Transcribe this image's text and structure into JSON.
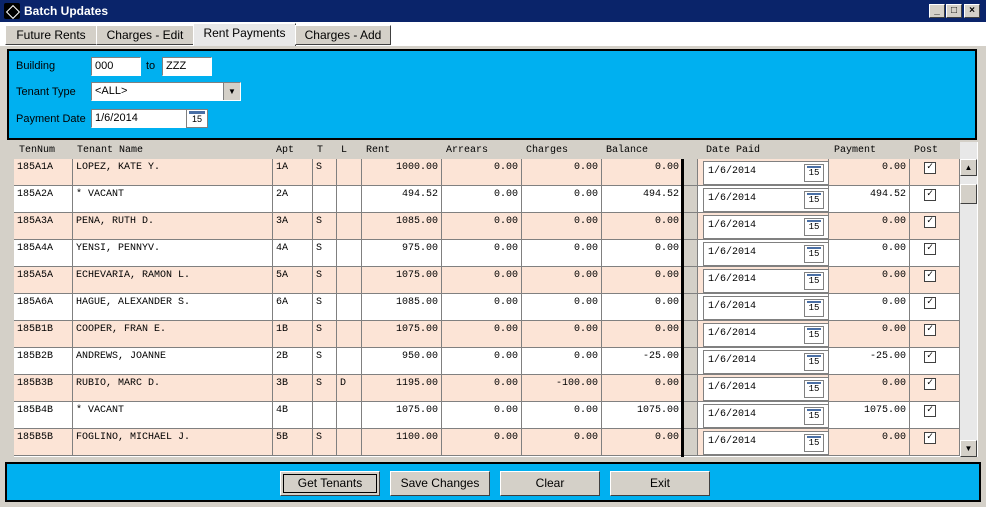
{
  "window": {
    "title": "Batch Updates"
  },
  "tabs": [
    "Future Rents",
    "Charges - Edit",
    "Rent Payments",
    "Charges - Add"
  ],
  "filter": {
    "building_label": "Building",
    "building_from": "000",
    "to_label": "to",
    "building_to": "ZZZ",
    "tenant_type_label": "Tenant Type",
    "tenant_type_value": "<ALL>",
    "payment_date_label": "Payment Date",
    "payment_date_value": "1/6/2014",
    "calendar_day": "15"
  },
  "grid": {
    "headers": [
      "TenNum",
      "Tenant Name",
      "Apt",
      "T",
      "L",
      "Rent",
      "Arrears",
      "Charges",
      "Balance",
      "Date Paid",
      "Payment",
      "Post"
    ],
    "rows": [
      {
        "tennum": "185A1A",
        "name": "LOPEZ, KATE Y.",
        "apt": "1A",
        "t": "S",
        "l": "",
        "rent": "1000.00",
        "arrears": "0.00",
        "charges": "0.00",
        "balance": "0.00",
        "date_paid": "1/6/2014",
        "payment": "0.00",
        "post": "✓"
      },
      {
        "tennum": "185A2A",
        "name": "* VACANT",
        "apt": "2A",
        "t": "",
        "l": "",
        "rent": "494.52",
        "arrears": "0.00",
        "charges": "0.00",
        "balance": "494.52",
        "date_paid": "1/6/2014",
        "payment": "494.52",
        "post": "✓"
      },
      {
        "tennum": "185A3A",
        "name": "PENA, RUTH D.",
        "apt": "3A",
        "t": "S",
        "l": "",
        "rent": "1085.00",
        "arrears": "0.00",
        "charges": "0.00",
        "balance": "0.00",
        "date_paid": "1/6/2014",
        "payment": "0.00",
        "post": "✓"
      },
      {
        "tennum": "185A4A",
        "name": "YENSI, PENNYV.",
        "apt": "4A",
        "t": "S",
        "l": "",
        "rent": "975.00",
        "arrears": "0.00",
        "charges": "0.00",
        "balance": "0.00",
        "date_paid": "1/6/2014",
        "payment": "0.00",
        "post": "✓"
      },
      {
        "tennum": "185A5A",
        "name": "ECHEVARIA, RAMON L.",
        "apt": "5A",
        "t": "S",
        "l": "",
        "rent": "1075.00",
        "arrears": "0.00",
        "charges": "0.00",
        "balance": "0.00",
        "date_paid": "1/6/2014",
        "payment": "0.00",
        "post": "✓"
      },
      {
        "tennum": "185A6A",
        "name": "HAGUE, ALEXANDER S.",
        "apt": "6A",
        "t": "S",
        "l": "",
        "rent": "1085.00",
        "arrears": "0.00",
        "charges": "0.00",
        "balance": "0.00",
        "date_paid": "1/6/2014",
        "payment": "0.00",
        "post": "✓"
      },
      {
        "tennum": "185B1B",
        "name": "COOPER, FRAN E.",
        "apt": "1B",
        "t": "S",
        "l": "",
        "rent": "1075.00",
        "arrears": "0.00",
        "charges": "0.00",
        "balance": "0.00",
        "date_paid": "1/6/2014",
        "payment": "0.00",
        "post": "✓"
      },
      {
        "tennum": "185B2B",
        "name": "ANDREWS, JOANNE",
        "apt": "2B",
        "t": "S",
        "l": "",
        "rent": "950.00",
        "arrears": "0.00",
        "charges": "0.00",
        "balance": "-25.00",
        "date_paid": "1/6/2014",
        "payment": "-25.00",
        "post": "✓"
      },
      {
        "tennum": "185B3B",
        "name": "RUBIO, MARC D.",
        "apt": "3B",
        "t": "S",
        "l": "D",
        "rent": "1195.00",
        "arrears": "0.00",
        "charges": "-100.00",
        "balance": "0.00",
        "date_paid": "1/6/2014",
        "payment": "0.00",
        "post": "✓"
      },
      {
        "tennum": "185B4B",
        "name": "* VACANT",
        "apt": "4B",
        "t": "",
        "l": "",
        "rent": "1075.00",
        "arrears": "0.00",
        "charges": "0.00",
        "balance": "1075.00",
        "date_paid": "1/6/2014",
        "payment": "1075.00",
        "post": "✓"
      },
      {
        "tennum": "185B5B",
        "name": "FOGLINO, MICHAEL J.",
        "apt": "5B",
        "t": "S",
        "l": "",
        "rent": "1100.00",
        "arrears": "0.00",
        "charges": "0.00",
        "balance": "0.00",
        "date_paid": "1/6/2014",
        "payment": "0.00",
        "post": "✓"
      }
    ]
  },
  "footer": {
    "get_tenants": "Get Tenants",
    "save_changes": "Save Changes",
    "clear": "Clear",
    "exit": "Exit"
  }
}
